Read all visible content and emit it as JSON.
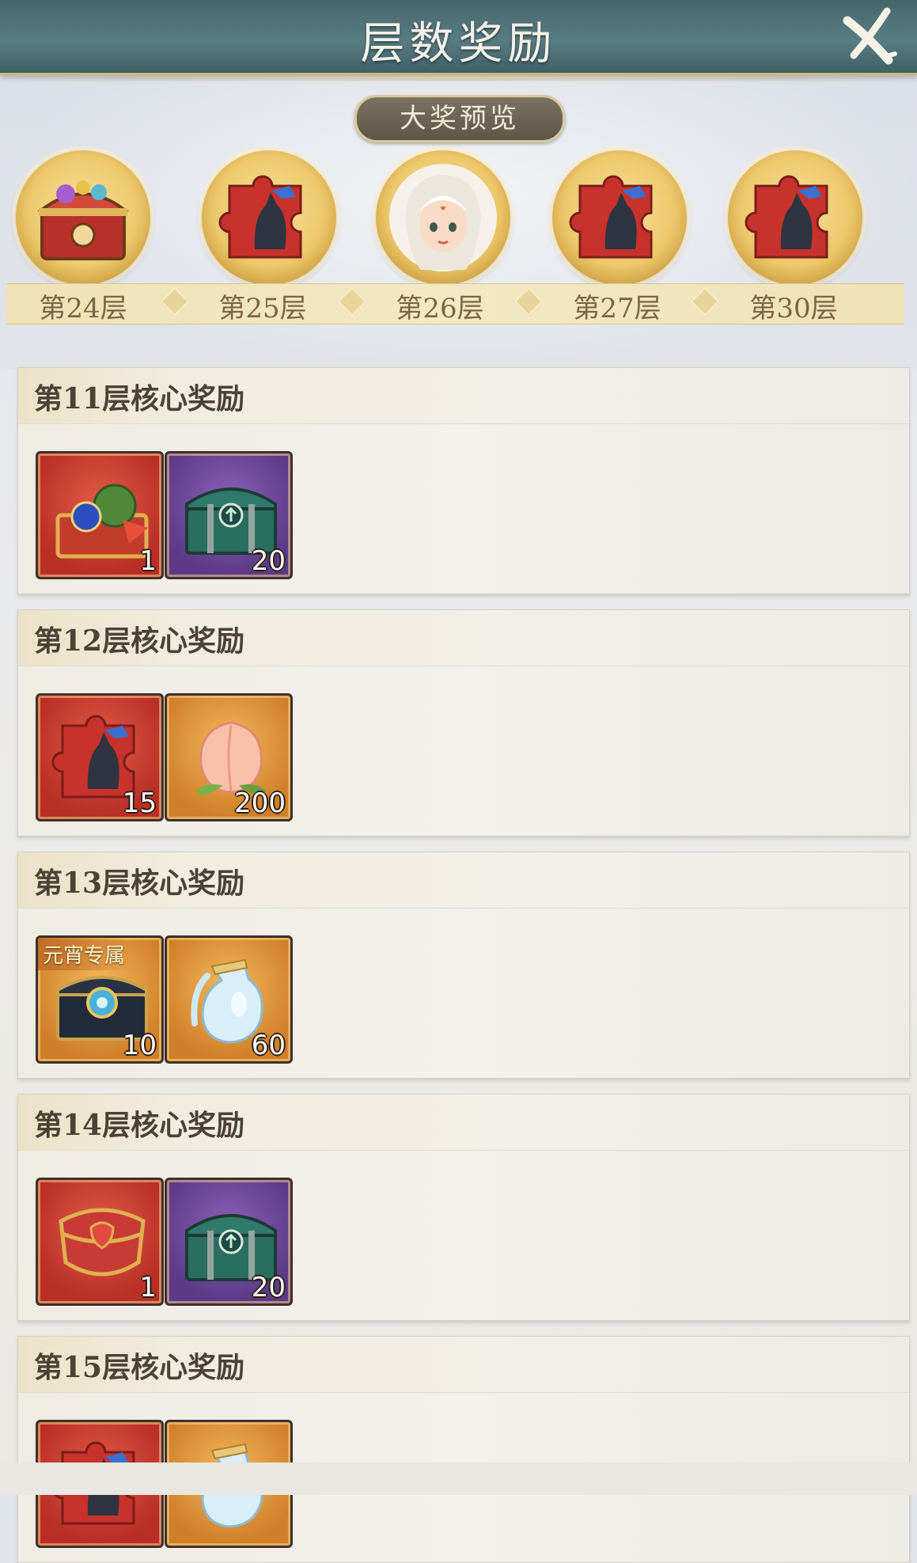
{
  "header": {
    "title": "层数奖励"
  },
  "preview": {
    "label": "大奖预览",
    "items": [
      {
        "floor": "第24层",
        "icon": "treasure-chest-icon"
      },
      {
        "floor": "第25层",
        "icon": "puzzle-piece-icon"
      },
      {
        "floor": "第26层",
        "icon": "character-portrait-icon"
      },
      {
        "floor": "第27层",
        "icon": "puzzle-piece-icon"
      },
      {
        "floor": "第30层",
        "icon": "puzzle-piece-icon"
      }
    ]
  },
  "rewards": [
    {
      "title": "第11层核心奖励",
      "items": [
        {
          "icon": "fruit-chest-icon",
          "quantity": "1",
          "frame": "red"
        },
        {
          "icon": "green-chest-icon",
          "quantity": "20",
          "frame": "purple"
        }
      ]
    },
    {
      "title": "第12层核心奖励",
      "items": [
        {
          "icon": "puzzle-piece-icon",
          "quantity": "15",
          "frame": "red"
        },
        {
          "icon": "peach-icon",
          "quantity": "200",
          "frame": "orange"
        }
      ]
    },
    {
      "title": "第13层核心奖励",
      "items": [
        {
          "icon": "lantern-chest-icon",
          "quantity": "10",
          "frame": "orange",
          "tag": "元宵专属"
        },
        {
          "icon": "water-jug-icon",
          "quantity": "60",
          "frame": "orange"
        }
      ]
    },
    {
      "title": "第14层核心奖励",
      "items": [
        {
          "icon": "red-chest-icon",
          "quantity": "1",
          "frame": "red"
        },
        {
          "icon": "green-chest-icon",
          "quantity": "20",
          "frame": "purple"
        }
      ]
    },
    {
      "title": "第15层核心奖励",
      "items": [
        {
          "icon": "puzzle-piece-icon",
          "quantity": "",
          "frame": "red"
        },
        {
          "icon": "water-jug-icon",
          "quantity": "",
          "frame": "orange"
        }
      ]
    }
  ],
  "colors": {
    "header": "#587d82",
    "gold": "#edc86a",
    "text": "#4b4235"
  }
}
